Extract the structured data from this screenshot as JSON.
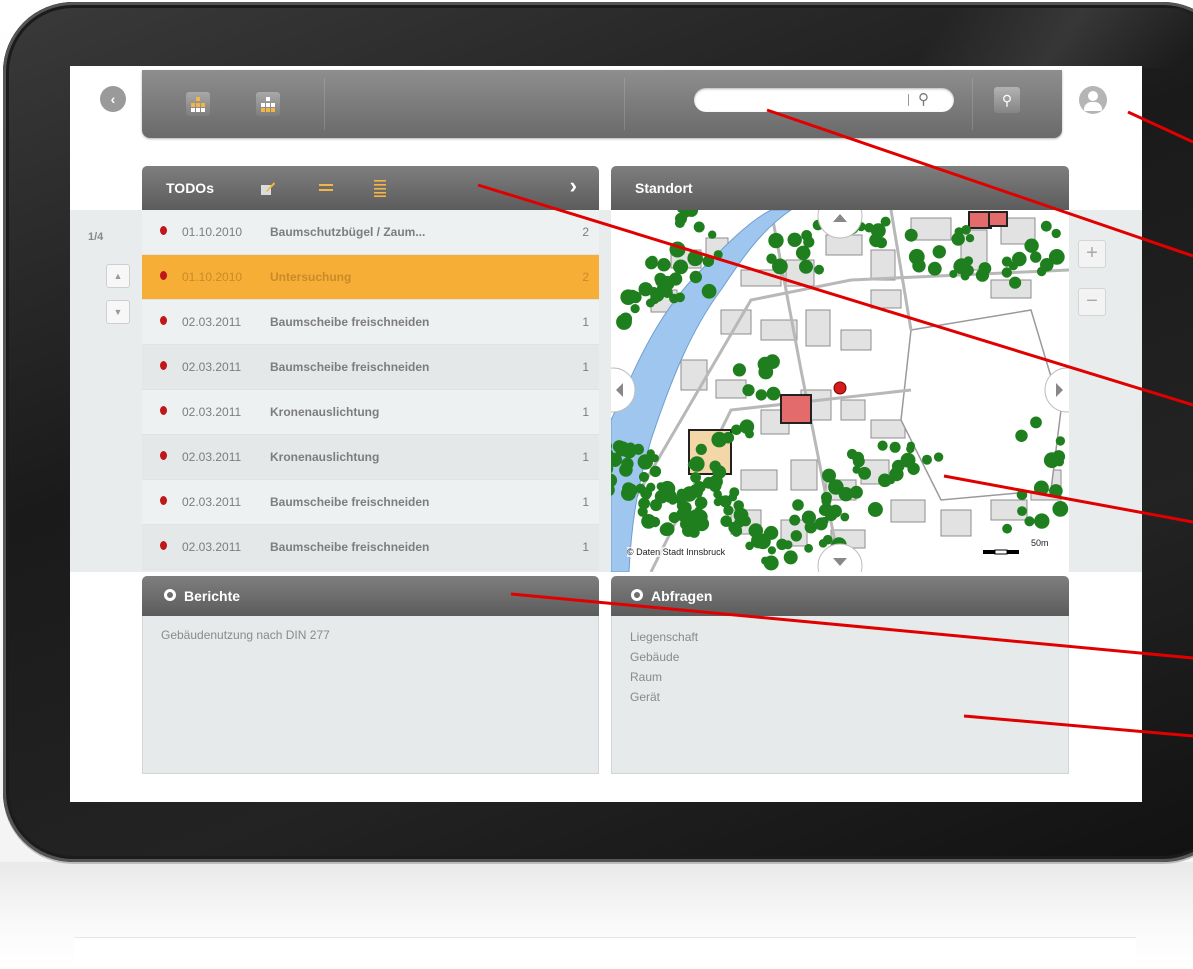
{
  "topbar": {
    "search_placeholder": "",
    "buttons": [
      "back-icon",
      "org-tree-icon",
      "org-tree-alt-icon",
      "search-icon",
      "advanced-search-icon",
      "user-icon"
    ]
  },
  "todos": {
    "title": "TODOs",
    "pager": "1/4",
    "next_glyph": "›",
    "up_glyph": "▲",
    "down_glyph": "▼",
    "rows": [
      {
        "date": "01.10.2010",
        "name": "Baumschutzbügel / Zaum...",
        "count": "2",
        "selected": false
      },
      {
        "date": "01.10.2010",
        "name": "Untersuchung",
        "count": "2",
        "selected": true
      },
      {
        "date": "02.03.2011",
        "name": "Baumscheibe freischneiden",
        "count": "1",
        "selected": false
      },
      {
        "date": "02.03.2011",
        "name": "Baumscheibe freischneiden",
        "count": "1",
        "selected": false
      },
      {
        "date": "02.03.2011",
        "name": "Kronenauslichtung",
        "count": "1",
        "selected": false
      },
      {
        "date": "02.03.2011",
        "name": "Kronenauslichtung",
        "count": "1",
        "selected": false
      },
      {
        "date": "02.03.2011",
        "name": "Baumscheibe freischneiden",
        "count": "1",
        "selected": false
      },
      {
        "date": "02.03.2011",
        "name": "Baumscheibe freischneiden",
        "count": "1",
        "selected": false
      }
    ]
  },
  "map": {
    "title": "Standort",
    "attribution": "© Daten Stadt Innsbruck",
    "scale": "50m",
    "zoom_in": "+",
    "zoom_out": "−"
  },
  "reports": {
    "title": "Berichte",
    "items": [
      "Gebäudenutzung nach DIN 277"
    ]
  },
  "queries": {
    "title": "Abfragen",
    "items": [
      "Liegenschaft",
      "Gebäude",
      "Raum",
      "Gerät"
    ]
  },
  "colors": {
    "accent": "#f7ae36",
    "header_bg": "#6a6a6a",
    "status_red": "#c01818",
    "tree_green": "#1f7f1f",
    "water": "#9ec6ee",
    "callout": "#e00000"
  }
}
